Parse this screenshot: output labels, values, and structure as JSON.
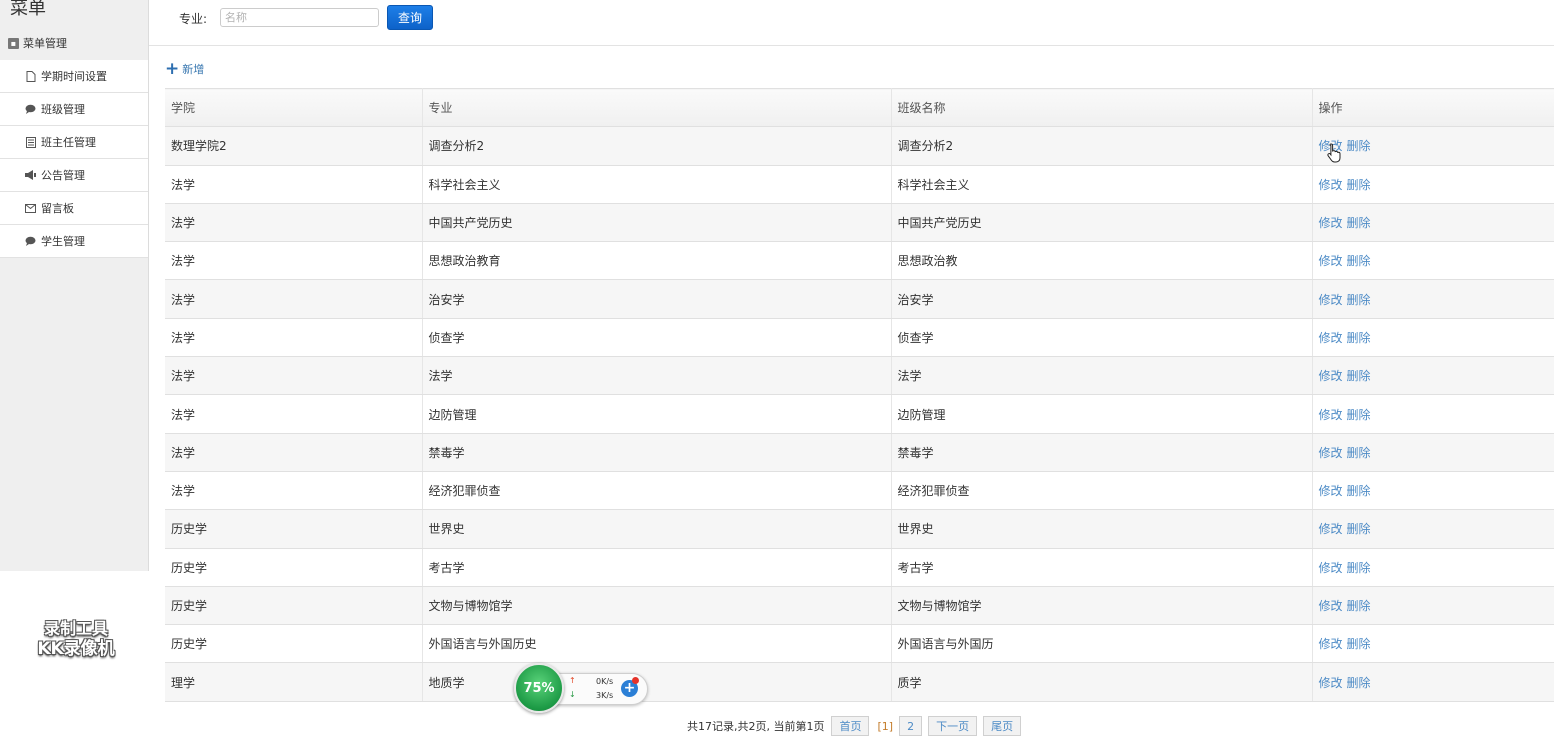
{
  "sidebar": {
    "title": "菜单",
    "group_label": "菜单管理",
    "items": [
      {
        "label": "学期时间设置",
        "icon": "file-icon"
      },
      {
        "label": "班级管理",
        "icon": "chat-icon"
      },
      {
        "label": "班主任管理",
        "icon": "list-icon"
      },
      {
        "label": "公告管理",
        "icon": "megaphone-icon"
      },
      {
        "label": "留言板",
        "icon": "envelope-icon"
      },
      {
        "label": "学生管理",
        "icon": "chat-icon"
      }
    ]
  },
  "search": {
    "label": "专业:",
    "placeholder": "名称",
    "button_label": "查询"
  },
  "toolbar": {
    "add_label": "新增"
  },
  "table": {
    "headers": [
      "学院",
      "专业",
      "班级名称",
      "操作"
    ],
    "edit_label": "修改",
    "delete_label": "删除",
    "rows": [
      {
        "college": "数理学院2",
        "major": "调查分析2",
        "class_name": "调查分析2"
      },
      {
        "college": "法学",
        "major": "科学社会主义",
        "class_name": "科学社会主义"
      },
      {
        "college": "法学",
        "major": "中国共产党历史",
        "class_name": "中国共产党历史"
      },
      {
        "college": "法学",
        "major": "思想政治教育",
        "class_name": "思想政治教"
      },
      {
        "college": "法学",
        "major": "治安学",
        "class_name": "治安学"
      },
      {
        "college": "法学",
        "major": "侦查学",
        "class_name": "侦查学"
      },
      {
        "college": "法学",
        "major": "法学",
        "class_name": "法学"
      },
      {
        "college": "法学",
        "major": "边防管理",
        "class_name": "边防管理"
      },
      {
        "college": "法学",
        "major": "禁毒学",
        "class_name": "禁毒学"
      },
      {
        "college": "法学",
        "major": "经济犯罪侦查",
        "class_name": "经济犯罪侦查"
      },
      {
        "college": "历史学",
        "major": "世界史",
        "class_name": "世界史"
      },
      {
        "college": "历史学",
        "major": "考古学",
        "class_name": "考古学"
      },
      {
        "college": "历史学",
        "major": "文物与博物馆学",
        "class_name": "文物与博物馆学"
      },
      {
        "college": "历史学",
        "major": "外国语言与外国历史",
        "class_name": "外国语言与外国历"
      },
      {
        "college": "理学",
        "major": "地质学",
        "class_name": "质学"
      }
    ]
  },
  "pagination": {
    "info": "共17记录,共2页, 当前第1页",
    "first_label": "首页",
    "current_page": "[1]",
    "page_2": "2",
    "next_label": "下一页",
    "last_label": "尾页"
  },
  "overlay": {
    "watermark_line1": "录制工具",
    "watermark_line2": "KK录像机",
    "speed_percent": "75%",
    "upload_rate": "0K/s",
    "download_rate": "3K/s"
  },
  "colors": {
    "accent": "#0d62c9",
    "link": "#4d8bc6",
    "sidebar_bg": "#efefef"
  }
}
